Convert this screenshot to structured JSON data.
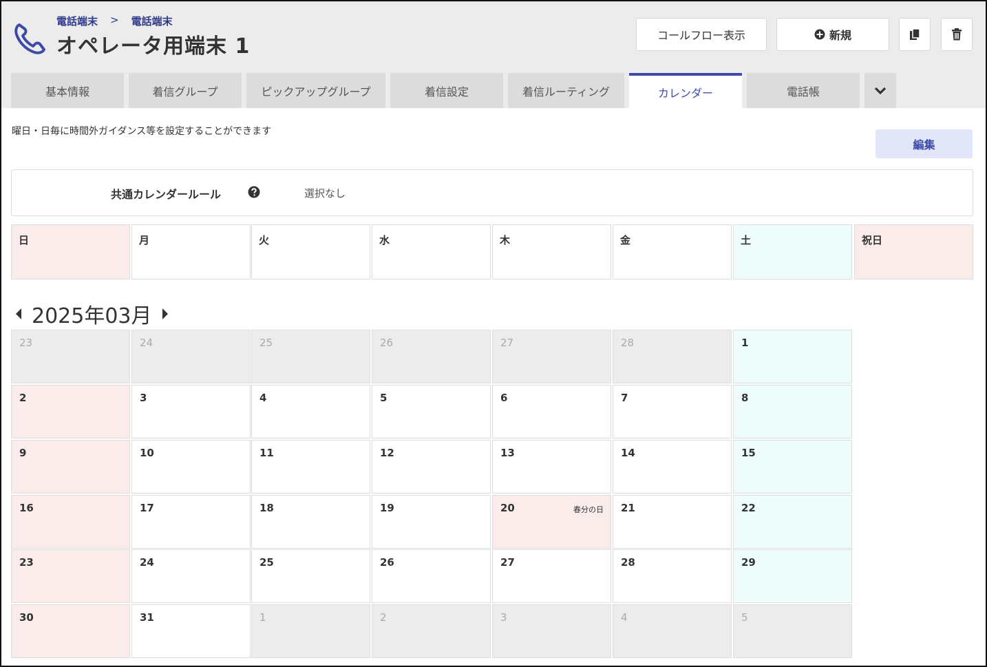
{
  "breadcrumb": {
    "items": [
      "電話端末",
      "電話端末"
    ],
    "separator": ">"
  },
  "page_title": "オペレータ用端末 1",
  "header_buttons": {
    "callflow_label": "コールフロー表示",
    "new_label": "新規",
    "copy_icon": "copy-icon",
    "trash_icon": "trash-icon"
  },
  "tabs": [
    {
      "label": "基本情報",
      "active": false
    },
    {
      "label": "着信グループ",
      "active": false
    },
    {
      "label": "ピックアップグループ",
      "active": false
    },
    {
      "label": "着信設定",
      "active": false
    },
    {
      "label": "着信ルーティング",
      "active": false
    },
    {
      "label": "カレンダー",
      "active": true
    },
    {
      "label": "電話帳",
      "active": false
    }
  ],
  "description": "曜日・日毎に時間外ガイダンス等を設定することができます",
  "edit_label": "編集",
  "common_rule": {
    "label": "共通カレンダールール",
    "value": "選択なし"
  },
  "weekdays": [
    "日",
    "月",
    "火",
    "水",
    "木",
    "金",
    "土",
    "祝日"
  ],
  "month_label": "2025年03月",
  "calendar_weeks": [
    [
      {
        "day": "23",
        "other": true
      },
      {
        "day": "24",
        "other": true
      },
      {
        "day": "25",
        "other": true
      },
      {
        "day": "26",
        "other": true
      },
      {
        "day": "27",
        "other": true
      },
      {
        "day": "28",
        "other": true
      },
      {
        "day": "1",
        "other": false
      }
    ],
    [
      {
        "day": "2"
      },
      {
        "day": "3"
      },
      {
        "day": "4"
      },
      {
        "day": "5"
      },
      {
        "day": "6"
      },
      {
        "day": "7"
      },
      {
        "day": "8"
      }
    ],
    [
      {
        "day": "9"
      },
      {
        "day": "10"
      },
      {
        "day": "11"
      },
      {
        "day": "12"
      },
      {
        "day": "13"
      },
      {
        "day": "14"
      },
      {
        "day": "15"
      }
    ],
    [
      {
        "day": "16"
      },
      {
        "day": "17"
      },
      {
        "day": "18"
      },
      {
        "day": "19"
      },
      {
        "day": "20",
        "holiday": "春分の日"
      },
      {
        "day": "21"
      },
      {
        "day": "22"
      }
    ],
    [
      {
        "day": "23"
      },
      {
        "day": "24"
      },
      {
        "day": "25"
      },
      {
        "day": "26"
      },
      {
        "day": "27"
      },
      {
        "day": "28"
      },
      {
        "day": "29"
      }
    ],
    [
      {
        "day": "30"
      },
      {
        "day": "31"
      },
      {
        "day": "1",
        "other": true
      },
      {
        "day": "2",
        "other": true
      },
      {
        "day": "3",
        "other": true
      },
      {
        "day": "4",
        "other": true
      },
      {
        "day": "5",
        "other": true
      }
    ]
  ],
  "colors": {
    "accent": "#3d4ba8",
    "sunday_bg": "#fbecec",
    "saturday_bg": "#effcfc",
    "other_month_bg": "#ececec"
  }
}
